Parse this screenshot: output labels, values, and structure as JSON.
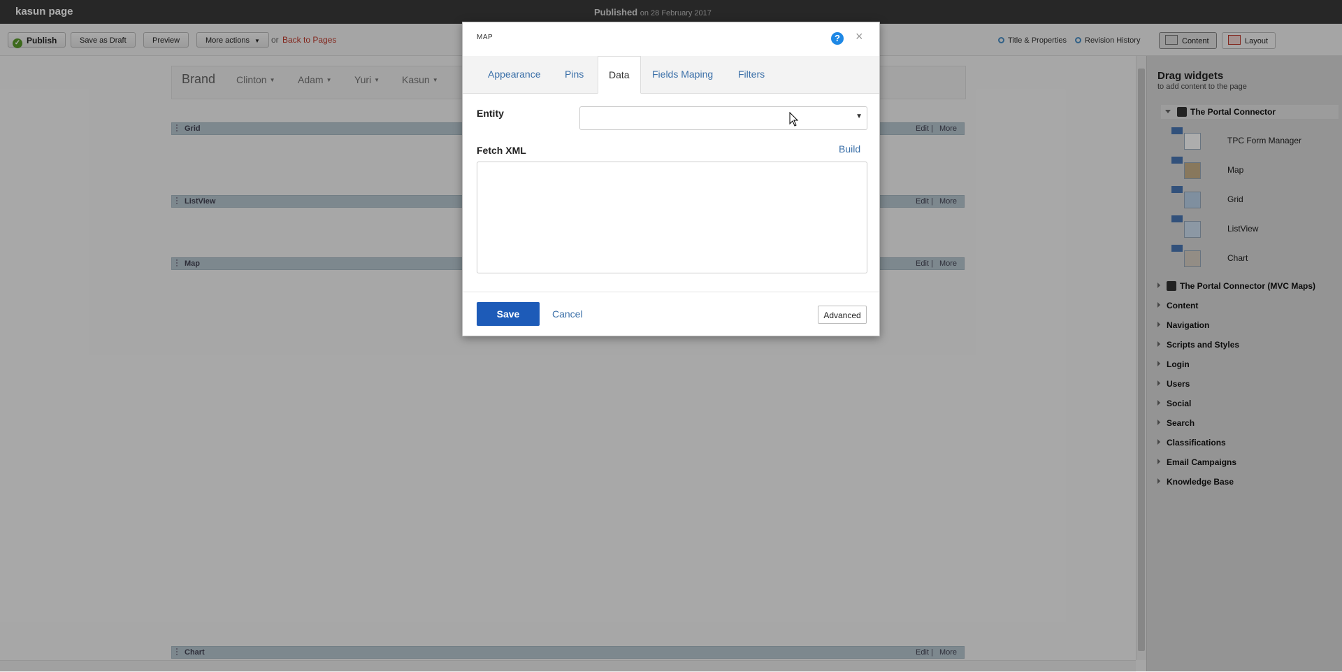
{
  "topbar": {
    "site_title": "kasun page",
    "status_label": "Published",
    "status_date": "on 28 February 2017"
  },
  "toolbar": {
    "publish": "Publish",
    "save_draft": "Save as Draft",
    "preview": "Preview",
    "more_actions": "More actions",
    "or_text": "or",
    "back_to_pages": "Back to Pages",
    "title_properties": "Title & Properties",
    "revision_history": "Revision History",
    "content_mode": "Content",
    "layout_mode": "Layout"
  },
  "page_nav": {
    "brand": "Brand",
    "items": [
      "Clinton",
      "Adam",
      "Yuri",
      "Kasun"
    ]
  },
  "zones": [
    {
      "label": "Grid",
      "edit": "Edit",
      "more": "More"
    },
    {
      "label": "ListView",
      "edit": "Edit",
      "more": "More"
    },
    {
      "label": "Map",
      "edit": "Edit",
      "more": "More"
    },
    {
      "label": "Chart",
      "edit": "Edit",
      "more": "More"
    }
  ],
  "right_panel": {
    "title": "Drag widgets",
    "subtitle": "to add content to the page",
    "expanded_group": "The Portal Connector",
    "widgets": [
      "TPC Form Manager",
      "Map",
      "Grid",
      "ListView",
      "Chart"
    ],
    "groups": [
      "The Portal Connector (MVC Maps)",
      "Content",
      "Navigation",
      "Scripts and Styles",
      "Login",
      "Users",
      "Social",
      "Search",
      "Classifications",
      "Email Campaigns",
      "Knowledge Base"
    ]
  },
  "modal": {
    "title": "MAP",
    "help": "?",
    "close": "×",
    "tabs": [
      "Appearance",
      "Pins",
      "Data",
      "Fields Maping",
      "Filters"
    ],
    "active_tab": "Data",
    "entity_label": "Entity",
    "entity_value": "",
    "fetch_xml_label": "Fetch XML",
    "build": "Build",
    "fetch_xml_value": "",
    "save": "Save",
    "cancel": "Cancel",
    "advanced": "Advanced"
  }
}
